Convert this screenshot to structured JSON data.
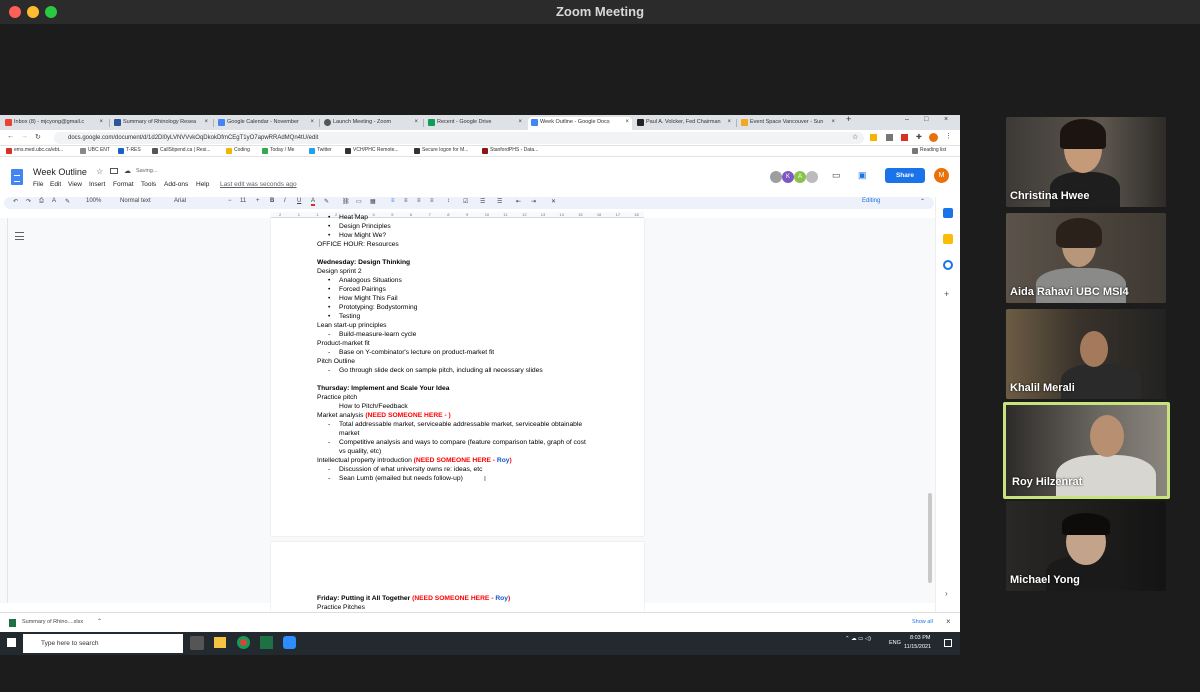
{
  "zoom": {
    "window_title": "Zoom Meeting",
    "participants": [
      {
        "name": "Christina Hwee"
      },
      {
        "name": "Aida Rahavi UBC MSI4"
      },
      {
        "name": "Khalil Merali"
      },
      {
        "name": "Roy Hilzenrat",
        "active_speaker": true
      },
      {
        "name": "Michael Yong"
      }
    ]
  },
  "browser": {
    "tabs": [
      {
        "label": "Inbox (8) - mjcyong@gmail.c",
        "icon": "gmail-icon"
      },
      {
        "label": "Summary of Rhinology Resea",
        "icon": "word-icon"
      },
      {
        "label": "Google Calendar - November",
        "icon": "calendar-icon"
      },
      {
        "label": "Launch Meeting - Zoom",
        "icon": "zoom-icon"
      },
      {
        "label": "Recent - Google Drive",
        "icon": "drive-icon"
      },
      {
        "label": "Week Outline - Google Docs",
        "icon": "docs-icon",
        "active": true
      },
      {
        "label": "Paul A. Volcker, Fed Chairman",
        "icon": "nyt-icon"
      },
      {
        "label": "Event Space Vancouver - Sun",
        "icon": "web-icon"
      }
    ],
    "url": "docs.google.com/document/d/1d2Dl0yLVNVVvkOqDkokDfmCEgT1yO7apwRRAdMQn4tU/edit",
    "bookmarks": [
      "ems.med.ubc.ca/ebt...",
      "UBC ENT",
      "T-RES",
      "CallStipend.ca | Resi...",
      "Coding",
      "Today / Me",
      "Twitter",
      "VCH/PHC Remote...",
      "Secure logon for M...",
      "StanfordPHS - Data..."
    ],
    "reading_list": "Reading list"
  },
  "docs": {
    "title": "Week Outline",
    "saving": "Saving...",
    "menu": [
      "File",
      "Edit",
      "View",
      "Insert",
      "Format",
      "Tools",
      "Add-ons",
      "Help"
    ],
    "last_edit": "Last edit was seconds ago",
    "share": "Share",
    "user_initial": "M",
    "toolbar": {
      "zoom": "100%",
      "style": "Normal text",
      "font": "Arial",
      "size": "11",
      "mode": "Editing"
    },
    "ruler": [
      "2",
      "1",
      "1",
      "2",
      "3",
      "4",
      "5",
      "6",
      "7",
      "8",
      "9",
      "10",
      "11",
      "12",
      "13",
      "14",
      "15",
      "16",
      "17",
      "18"
    ],
    "lines": [
      {
        "text": "Heat Map",
        "kind": "dot"
      },
      {
        "text": "Design Principles",
        "kind": "dot"
      },
      {
        "text": "How Might We?",
        "kind": "dot"
      },
      {
        "text": "OFFICE HOUR: Resources",
        "kind": "plain"
      },
      {
        "text": "Wednesday: Design Thinking",
        "kind": "bold"
      },
      {
        "text": "Design sprint 2",
        "kind": "plain"
      },
      {
        "text": "Analogous Situations",
        "kind": "dot"
      },
      {
        "text": "Forced Pairings",
        "kind": "dot"
      },
      {
        "text": "How Might This Fail",
        "kind": "dot"
      },
      {
        "text": "Prototyping: Bodystorming",
        "kind": "dot"
      },
      {
        "text": "Testing",
        "kind": "dot"
      },
      {
        "text": "Lean start-up principles",
        "kind": "plain"
      },
      {
        "text": "Build-measure-learn cycle",
        "kind": "dash"
      },
      {
        "text": "Product-market fit",
        "kind": "plain"
      },
      {
        "text": "Base on Y-combinator's lecture on product-market fit",
        "kind": "dash"
      },
      {
        "text": "Pitch Outline",
        "kind": "plain"
      },
      {
        "text": "Go through slide deck on sample pitch, including all necessary slides",
        "kind": "dash"
      },
      {
        "text": "Thursday: Implement and Scale Your Idea",
        "kind": "bold"
      },
      {
        "text": "Practice pitch",
        "kind": "plain"
      },
      {
        "text": "How to Pitch/Feedback",
        "kind": "indent"
      },
      {
        "text": "Market analysis ",
        "red": "(NEED SOMEONE HERE - )",
        "kind": "plain"
      },
      {
        "text": "Total addressable market, serviceable addressable market, serviceable obtainable",
        "kind": "dash"
      },
      {
        "text": "market",
        "kind": "indent"
      },
      {
        "text": "Competitive analysis and ways to compare (feature comparison table, graph of cost",
        "kind": "dash"
      },
      {
        "text": "vs quality, etc)",
        "kind": "indent"
      },
      {
        "text": "Intellectual property introduction ",
        "red": "(NEED SOMEONE HERE - ",
        "blue": "Roy",
        "red_end": ")",
        "kind": "plain"
      },
      {
        "text": "Discussion of what university owns re: ideas, etc",
        "kind": "dash"
      },
      {
        "text": "Sean Lumb (emailed but needs follow-up)",
        "kind": "dash"
      }
    ],
    "page2": {
      "heading": "Friday: Putting it All Together ",
      "heading_red": "(NEED SOMEONE HERE - ",
      "heading_blue": "Roy",
      "heading_red_end": ")",
      "line": "Practice Pitches"
    }
  },
  "download": {
    "file": "Summary of Rhino....xlsx",
    "show_all": "Show all"
  },
  "taskbar": {
    "search": "Type here to search",
    "time": "8:03 PM",
    "date": "11/15/2021",
    "lang": "ENG"
  }
}
